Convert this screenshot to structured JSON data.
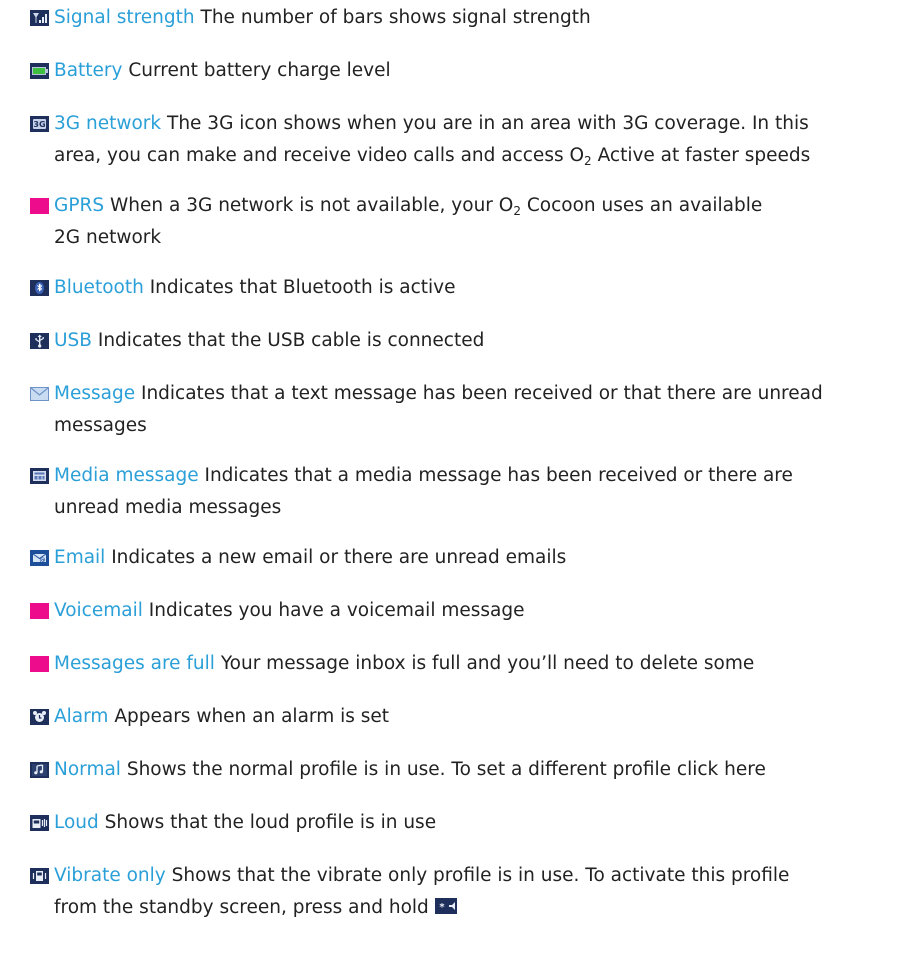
{
  "entries": [
    {
      "term": "Signal strength",
      "desc": "The number of bars shows signal strength",
      "icon": "signal-strength-icon"
    },
    {
      "term": "Battery",
      "desc": "Current battery charge level",
      "icon": "battery-icon"
    },
    {
      "term": "3G network",
      "desc_a": "The 3G icon shows when you are in an area with 3G coverage. In this",
      "desc_b": "area, you can make and receive video calls and access O",
      "desc_sub": "2",
      "desc_c": " Active at faster speeds",
      "icon": "3g-network-icon"
    },
    {
      "term": "GPRS",
      "desc_a": "When a 3G network is not available, your O",
      "desc_sub": "2",
      "desc_b": " Cocoon uses an available",
      "desc_c": "2G network",
      "icon": "gprs-icon"
    },
    {
      "term": "Bluetooth",
      "desc": "Indicates that Bluetooth is active",
      "icon": "bluetooth-icon"
    },
    {
      "term": "USB",
      "desc": "Indicates that the USB cable is connected",
      "icon": "usb-icon"
    },
    {
      "term": "Message",
      "desc_a": "Indicates that a text message has been received or that there are unread",
      "desc_b": "messages",
      "icon": "message-envelope-icon"
    },
    {
      "term": "Media message",
      "desc_a": "Indicates that a media message has been received or there are",
      "desc_b": "unread media messages",
      "icon": "media-message-icon"
    },
    {
      "term": "Email",
      "desc": "Indicates a new email or there are unread emails",
      "icon": "email-icon"
    },
    {
      "term": "Voicemail",
      "desc": "Indicates you have a voicemail message",
      "icon": "voicemail-icon"
    },
    {
      "term": "Messages are full",
      "desc": "Your message inbox is full and you’ll need to delete some",
      "icon": "messages-full-icon"
    },
    {
      "term": "Alarm",
      "desc": "Appears when an alarm is set",
      "icon": "alarm-icon"
    },
    {
      "term": "Normal",
      "desc": "Shows the normal profile is in use. To set a different profile click here",
      "icon": "normal-profile-icon"
    },
    {
      "term": "Loud",
      "desc": "Shows that the loud profile is in use",
      "icon": "loud-profile-icon"
    },
    {
      "term": "Vibrate only",
      "desc_a": "Shows that the vibrate only profile is in use. To activate this profile",
      "desc_b": "from the standby screen, press and hold",
      "icon": "vibrate-profile-icon",
      "key_icon": "star-key-icon"
    }
  ],
  "colors": {
    "term": "#2a9fd8",
    "text": "#222222",
    "placeholder_icon": "#ec0c8c"
  }
}
